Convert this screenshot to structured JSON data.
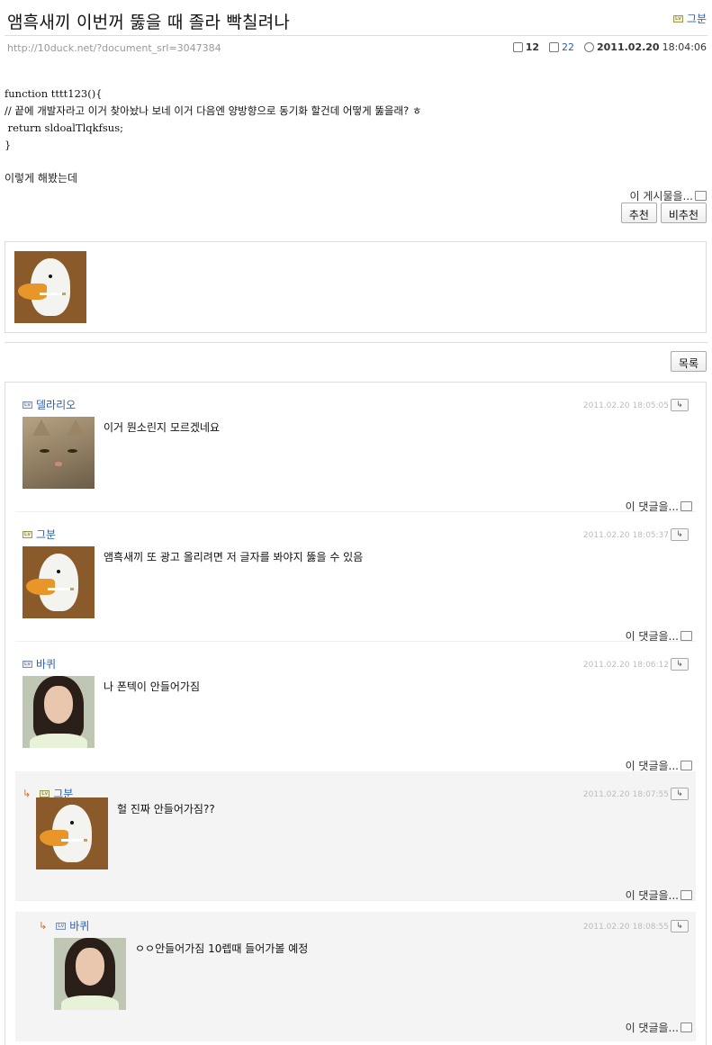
{
  "post": {
    "title": "앰흑새끼 이번꺼 뚫을 때 졸라 빡칠려나",
    "author": "그분",
    "url": "http://10duck.net/?document_srl=3047384",
    "comment_count": "12",
    "view_count": "22",
    "date": "2011.02.20",
    "time": "18:04:06",
    "code_lines": [
      "function tttt123(){",
      "// 끝에 개발자라고 이거 찾아놨나 보네 이거 다음엔 양방향으로 동기화 할건데 어떻게 뚫을래? ㅎ",
      " return sldoalTlqkfsus;",
      "}"
    ],
    "after_text": "이렇게 해봤는데",
    "this_post_label": "이 게시물을...",
    "recommend_label": "추천",
    "not_recommend_label": "비추천",
    "list_label": "목록"
  },
  "comments": [
    {
      "author": "델라리오",
      "date": "2011.02.20",
      "time": "18:05:05",
      "text": "이거 뭔소린지 모르겠네요",
      "more": "이 댓글을...",
      "avatar": "cat",
      "level_icon": "blue"
    },
    {
      "author": "그분",
      "date": "2011.02.20",
      "time": "18:05:37",
      "text": "앰흑새끼 또 광고 올리려면 저 글자를 봐야지 뚫을 수 있음",
      "more": "이 댓글을...",
      "avatar": "duck",
      "level_icon": "yellow"
    },
    {
      "author": "바퀴",
      "date": "2011.02.20",
      "time": "18:06:12",
      "text": "나 폰텍이 안들어가짐",
      "more": "이 댓글을...",
      "avatar": "girl",
      "level_icon": "blue"
    },
    {
      "author": "그분",
      "date": "2011.02.20",
      "time": "18:07:55",
      "text": "헐 진짜 안들어가짐??",
      "more": "이 댓글을...",
      "avatar": "duck",
      "level_icon": "yellow",
      "reply": true
    },
    {
      "author": "바퀴",
      "date": "2011.02.20",
      "time": "18:08:55",
      "text": "ㅇㅇ안들어가짐 10렙때 들어가볼 예정",
      "more": "이 댓글을...",
      "avatar": "girl",
      "level_icon": "blue",
      "reply": true
    }
  ],
  "icons": {
    "comment": "speech-bubble-icon",
    "views": "document-icon",
    "time": "clock-icon",
    "reply": "reply-arrow-icon"
  }
}
